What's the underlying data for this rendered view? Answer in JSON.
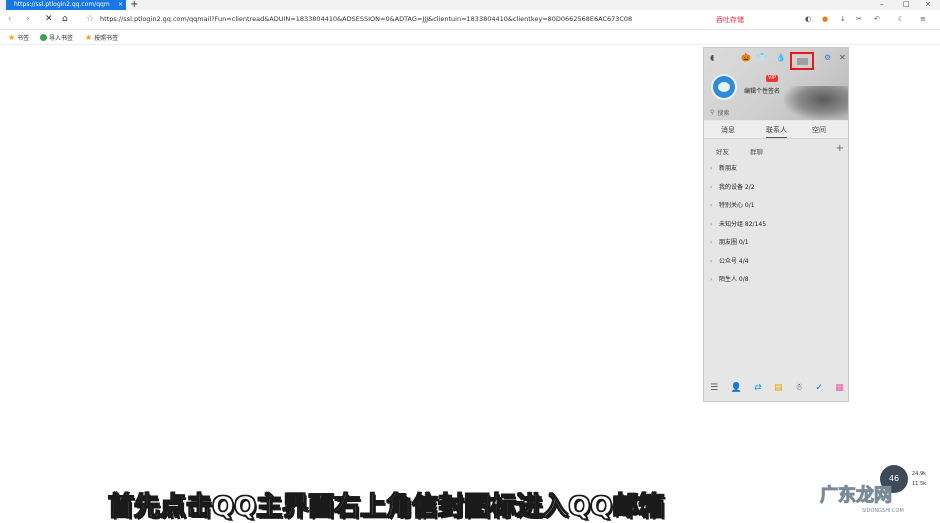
{
  "tab": {
    "title": "https://ssl.ptlogin2.qq.com/qqm",
    "close": "×",
    "new": "+"
  },
  "window": {
    "min": "–",
    "max": "□",
    "close": "×"
  },
  "address": {
    "url": "https://ssl.ptlogin2.qq.com/qqmail?Fun=clientread&ADUIN=1833804410&ADSESSION=0&ADTAG=JJJ&clientuin=1833804410&clientkey=80D0662568E6AC673C08",
    "back": "‹",
    "forward": "›",
    "stop": "✕",
    "home": "⌂",
    "fav": "☆",
    "icp": "吞吐存储"
  },
  "bookmarks": [
    {
      "icon": "★",
      "label": "书签"
    },
    {
      "icon": "●",
      "label": "导入书签"
    },
    {
      "icon": "★",
      "label": "按照书签"
    }
  ],
  "qq": {
    "header_icons": [
      "🎃",
      "👕",
      "💧",
      "✉",
      "⚙",
      "✕"
    ],
    "vip": "VIP",
    "signature": "编辑个性签名",
    "search_placeholder": "搜索",
    "main_tabs": [
      "消息",
      "联系人",
      "空间"
    ],
    "sub_tabs": [
      "好友",
      "群聊"
    ],
    "plus": "+",
    "groups": [
      "新朋友",
      "我的设备 2/2",
      "特别关心 0/1",
      "未知分组 82/145",
      "朋友圈 0/1",
      "公众号 4/4",
      "陌生人 0/8"
    ],
    "chevron": "›",
    "bottom_icons": [
      "☰",
      "👤",
      "⇄",
      "▤",
      "☃",
      "✓",
      "▦"
    ]
  },
  "weather": {
    "value": "46",
    "line1": "24.9k",
    "line2": "11.5k"
  },
  "caption": "首先点击QQ主界面右上角信封图标进入QQ邮箱",
  "watermark": {
    "main": "广东龙网",
    "sub": "SIDONGSHI.COM"
  }
}
